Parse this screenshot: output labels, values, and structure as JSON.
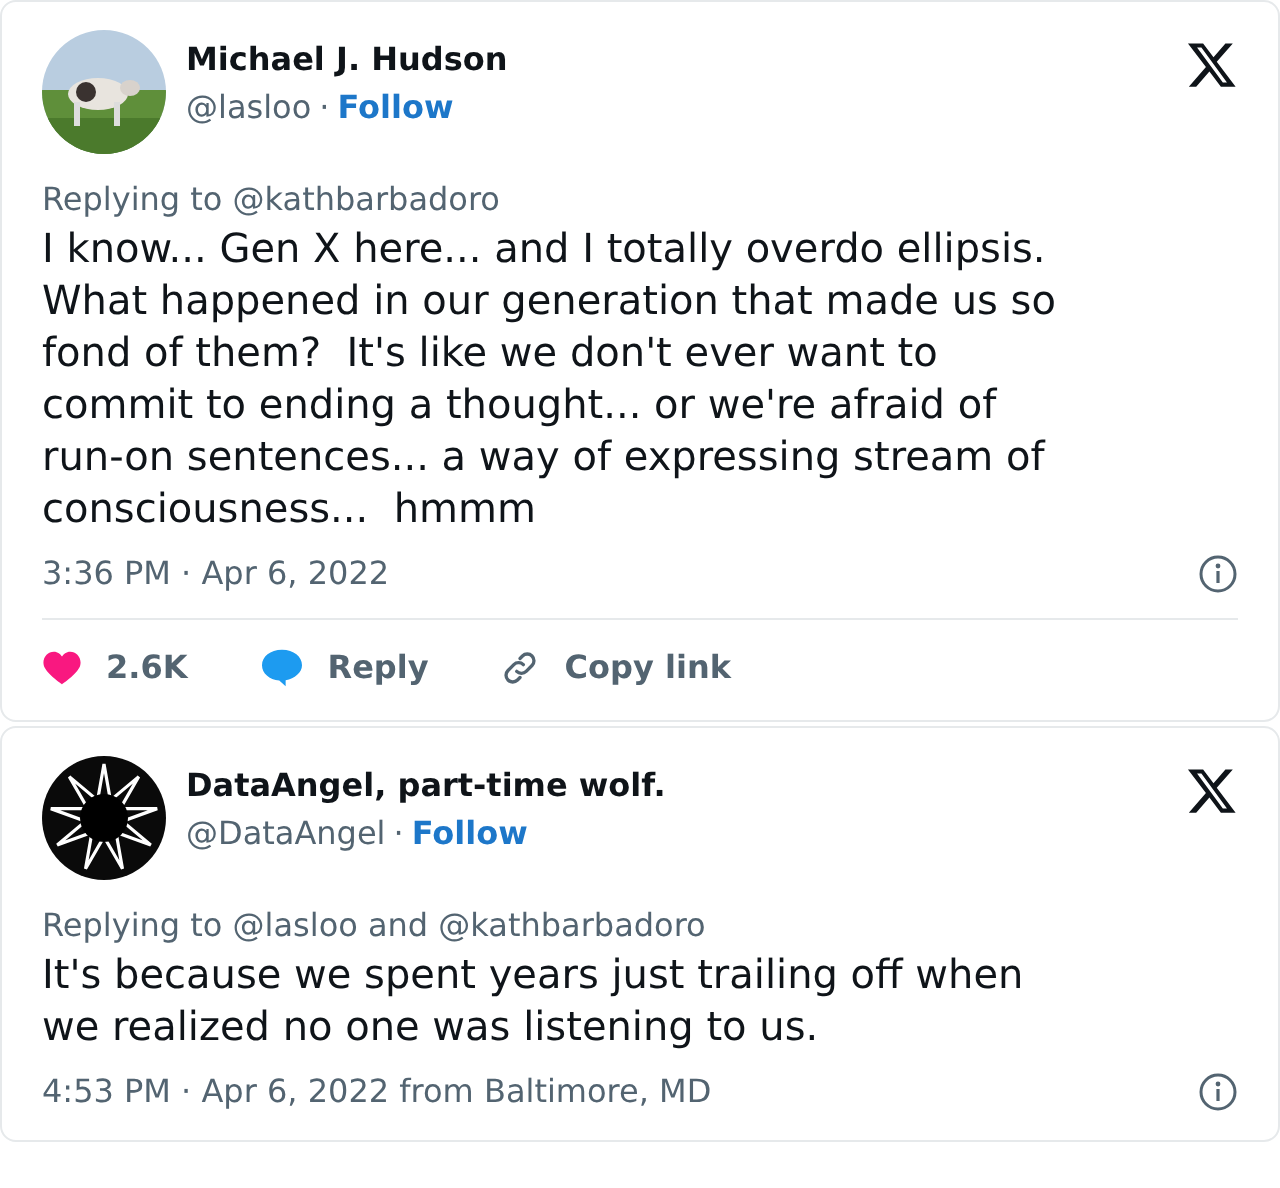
{
  "tweets": [
    {
      "name": "Michael J. Hudson",
      "handle": "@lasloo",
      "separator": "·",
      "follow": "Follow",
      "replying": "Replying to @kathbarbadoro",
      "text": "I know... Gen X here... and I totally overdo ellipsis.\nWhat happened in our generation that made us so\nfond of them?  It's like we don't ever want to\ncommit to ending a thought... or we're afraid of\nrun-on sentences... a way of expressing stream of\nconsciousness...  hmmm",
      "timestamp": "3:36 PM · Apr 6, 2022",
      "actions": [
        {
          "kind": "like",
          "label": "2.6K"
        },
        {
          "kind": "reply",
          "label": "Reply"
        },
        {
          "kind": "copy",
          "label": "Copy link"
        }
      ]
    },
    {
      "avatar": {
        "kind": "logo"
      },
      "name": "DataAngel, part-time wolf.",
      "handle": "@DataAngel",
      "separator": "·",
      "follow": "Follow",
      "replying": "Replying to @lasloo and @kathbarbadoro",
      "text": "It's because we spent years just trailing off when\nwe realized no one was listening to us.",
      "timestamp": "4:53 PM · Apr 6, 2022 from Baltimore, MD"
    }
  ]
}
